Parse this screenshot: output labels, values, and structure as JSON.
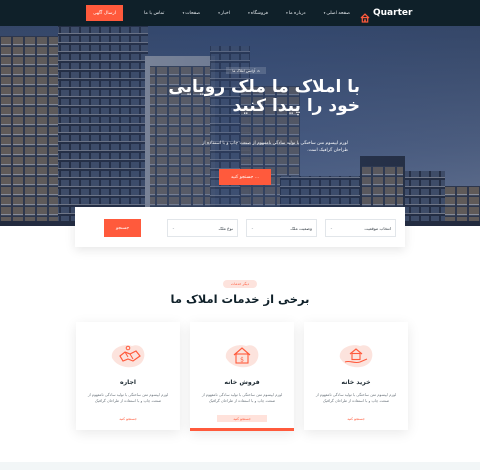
{
  "header": {
    "logo_text": "Quarter",
    "nav": [
      {
        "label": "صفحه اصلی",
        "has_caret": true
      },
      {
        "label": "درباره ما",
        "has_caret": true
      },
      {
        "label": "فروشگاه",
        "has_caret": true
      },
      {
        "label": "اخبار",
        "has_caret": true
      },
      {
        "label": "صفحات",
        "has_caret": true
      },
      {
        "label": "تماس با ما",
        "has_caret": false
      }
    ],
    "cta_label": "ارسال آگهی",
    "icons": {
      "logo": "house-logo-icon",
      "caret": "chevron-down-icon"
    }
  },
  "hero": {
    "breadcrumb": "آژانس املاک ما",
    "title": "با املاک ما ملک رویایی خود را پیدا کنید",
    "description": "لورم ایپسوم متن ساختگی با تولید سادگی نامفهوم از صنعت چاپ و با استفاده از طراحان گرافیک است.",
    "button_label": "جستجو کنید ..."
  },
  "search": {
    "fields": [
      {
        "label": "انتخاب موقعیت"
      },
      {
        "label": "وضعیت ملک"
      },
      {
        "label": "نوع ملک"
      },
      {
        "label": ""
      }
    ],
    "button_label": "جستجو"
  },
  "services": {
    "badge": "دیگر خدمات",
    "title": "برخی از خدمات املاک ما",
    "cards": [
      {
        "title": "اجاره",
        "description": "لورم ایپسوم متن ساختگی با تولید سادگی نامفهوم از صنعت چاپ و با استفاده از طراحان گرافیک",
        "link": "جستجو کنید",
        "icon": "handshake-icon",
        "active": false
      },
      {
        "title": "فروش خانه",
        "description": "لورم ایپسوم متن ساختگی با تولید سادگی نامفهوم از صنعت چاپ و با استفاده از طراحان گرافیک",
        "link": "جستجو کنید",
        "icon": "house-sale-icon",
        "active": true
      },
      {
        "title": "خرید خانه",
        "description": "لورم ایپسوم متن ساختگی با تولید سادگی نامفهوم از صنعت چاپ و با استفاده از طراحان گرافیک",
        "link": "جستجو کنید",
        "icon": "house-in-hand-icon",
        "active": false
      }
    ]
  },
  "colors": {
    "accent": "#ff5a3c",
    "header_bg": "#0f2029",
    "badge_bg": "#fde3dd"
  }
}
